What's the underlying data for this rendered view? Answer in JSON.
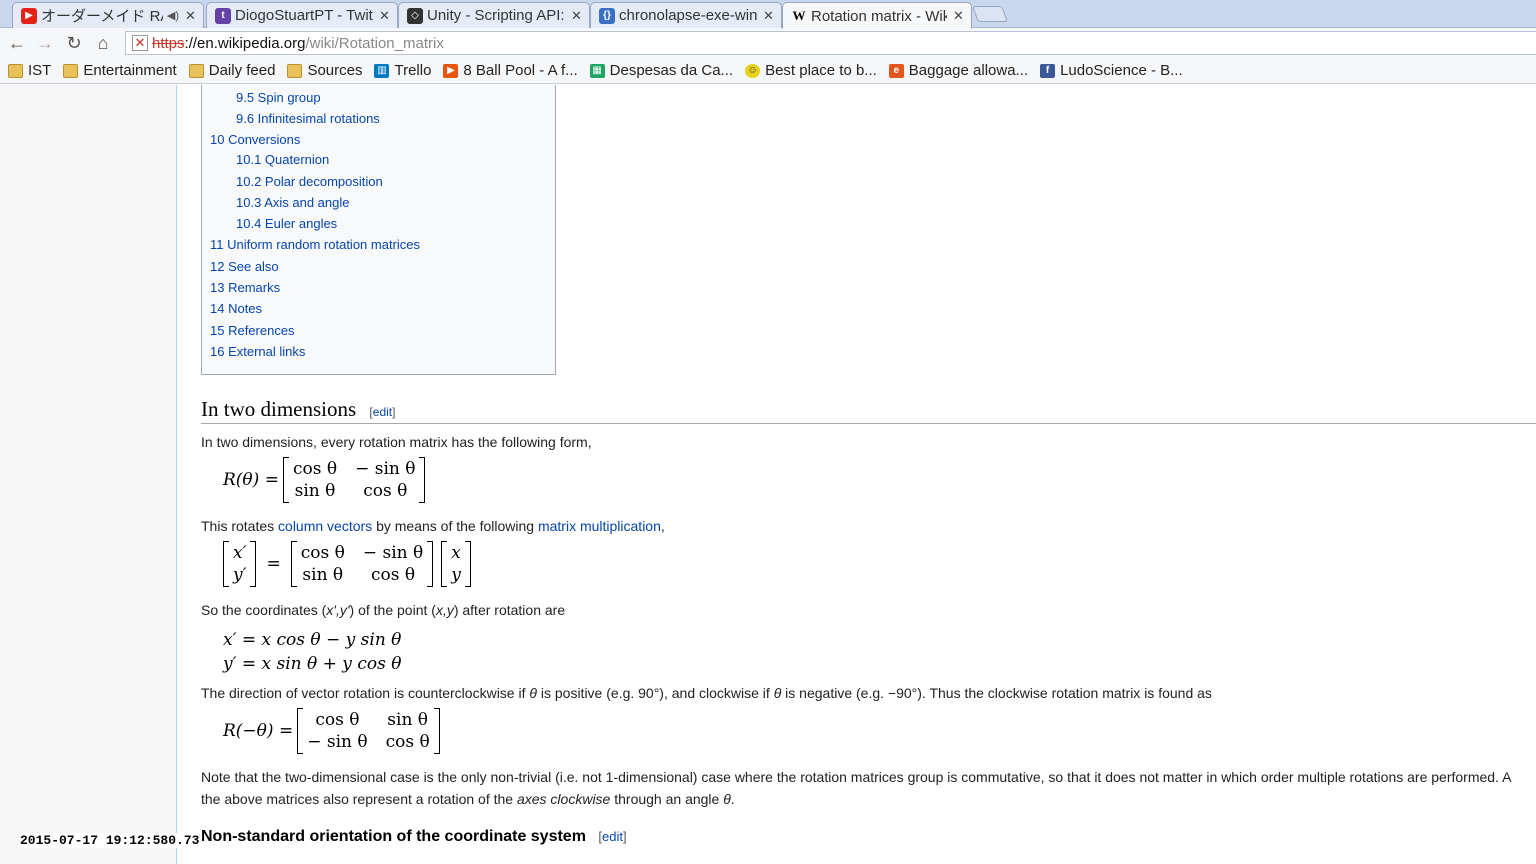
{
  "tabs": [
    {
      "title": "オーダーメイド RADWIN",
      "active": false,
      "icon": "youtube-icon",
      "color": "#e62117"
    },
    {
      "title": "DiogoStuartPT - Twit",
      "active": false,
      "icon": "twitch-icon",
      "color": "#6441a5"
    },
    {
      "title": "Unity - Scripting API:",
      "active": false,
      "icon": "unity-icon",
      "color": "#333333"
    },
    {
      "title": "chronolapse-exe-win",
      "active": false,
      "icon": "google-code-icon",
      "color": "#3a6fc4"
    },
    {
      "title": "Rotation matrix - Wik",
      "active": true,
      "icon": "wikipedia-icon",
      "color": "#000000"
    }
  ],
  "toolbar": {
    "url_scheme": "https",
    "url_host": "://en.wikipedia.org",
    "url_path": "/wiki/Rotation_matrix"
  },
  "bookmarks": [
    {
      "label": "IST",
      "icon": "folder-icon"
    },
    {
      "label": "Entertainment",
      "icon": "folder-icon"
    },
    {
      "label": "Daily feed",
      "icon": "folder-icon"
    },
    {
      "label": "Sources",
      "icon": "folder-icon"
    },
    {
      "label": "Trello",
      "icon": "trello-icon",
      "color": "#0079bf"
    },
    {
      "label": "8 Ball Pool - A f...",
      "icon": "play-icon",
      "color": "#e8550c"
    },
    {
      "label": "Despesas da Ca...",
      "icon": "sheets-icon",
      "color": "#1fa463"
    },
    {
      "label": "Best place to b...",
      "icon": "smiley-icon",
      "color": "#e8d21c"
    },
    {
      "label": "Baggage allowa...",
      "icon": "ebookers-icon",
      "color": "#e2571e"
    },
    {
      "label": "LudoScience - B...",
      "icon": "facebook-icon",
      "color": "#3b5998"
    }
  ],
  "toc": [
    {
      "label": "9.5 Spin group",
      "level": 2
    },
    {
      "label": "9.6 Infinitesimal rotations",
      "level": 2
    },
    {
      "label": "10 Conversions",
      "level": 1
    },
    {
      "label": "10.1 Quaternion",
      "level": 2
    },
    {
      "label": "10.2 Polar decomposition",
      "level": 2
    },
    {
      "label": "10.3 Axis and angle",
      "level": 2
    },
    {
      "label": "10.4 Euler angles",
      "level": 2
    },
    {
      "label": "11 Uniform random rotation matrices",
      "level": 1
    },
    {
      "label": "12 See also",
      "level": 1
    },
    {
      "label": "13 Remarks",
      "level": 1
    },
    {
      "label": "14 Notes",
      "level": 1
    },
    {
      "label": "15 References",
      "level": 1
    },
    {
      "label": "16 External links",
      "level": 1
    }
  ],
  "article": {
    "section_title": "In two dimensions",
    "edit_label": "edit",
    "p1": "In two dimensions, every rotation matrix has the following form,",
    "p2_a": "This rotates ",
    "p2_link1": "column vectors",
    "p2_b": " by means of the following ",
    "p2_link2": "matrix multiplication",
    "p2_c": ",",
    "p3_a": "So the coordinates (",
    "p3_b": "x',y'",
    "p3_c": ") of the point (",
    "p3_d": "x,y",
    "p3_e": ") after rotation are",
    "p4_a": "The direction of vector rotation is counterclockwise if ",
    "p4_theta": "θ",
    "p4_b": " is positive (e.g. 90°), and clockwise if ",
    "p4_c": " is negative (e.g. −90°). Thus the clockwise rotation matrix is found as",
    "p5": "Note that the two-dimensional case is the only non-trivial (i.e. not 1-dimensional) case where the rotation matrices group is commutative, so that it does not matter in which order multiple rotations are performed. A",
    "p6_a": "the above matrices also represent a rotation of the ",
    "p6_em": "axes clockwise",
    "p6_b": " through an angle ",
    "p6_theta": "θ",
    "p6_c": ".",
    "subsection_title": "Non-standard orientation of the coordinate system",
    "math": {
      "r_theta": "R(θ) =",
      "r_neg_theta": "R(−θ) =",
      "cos": "cos θ",
      "neg_sin": "− sin θ",
      "sin": "sin θ",
      "xp": "x′",
      "yp": "y′",
      "x": "x",
      "y": "y",
      "eq": "=",
      "eq1": "x′ = x cos θ − y sin θ",
      "eq2": "y′ = x sin θ + y cos θ"
    }
  },
  "timestamp": "2015-07-17 19:12:580.73"
}
